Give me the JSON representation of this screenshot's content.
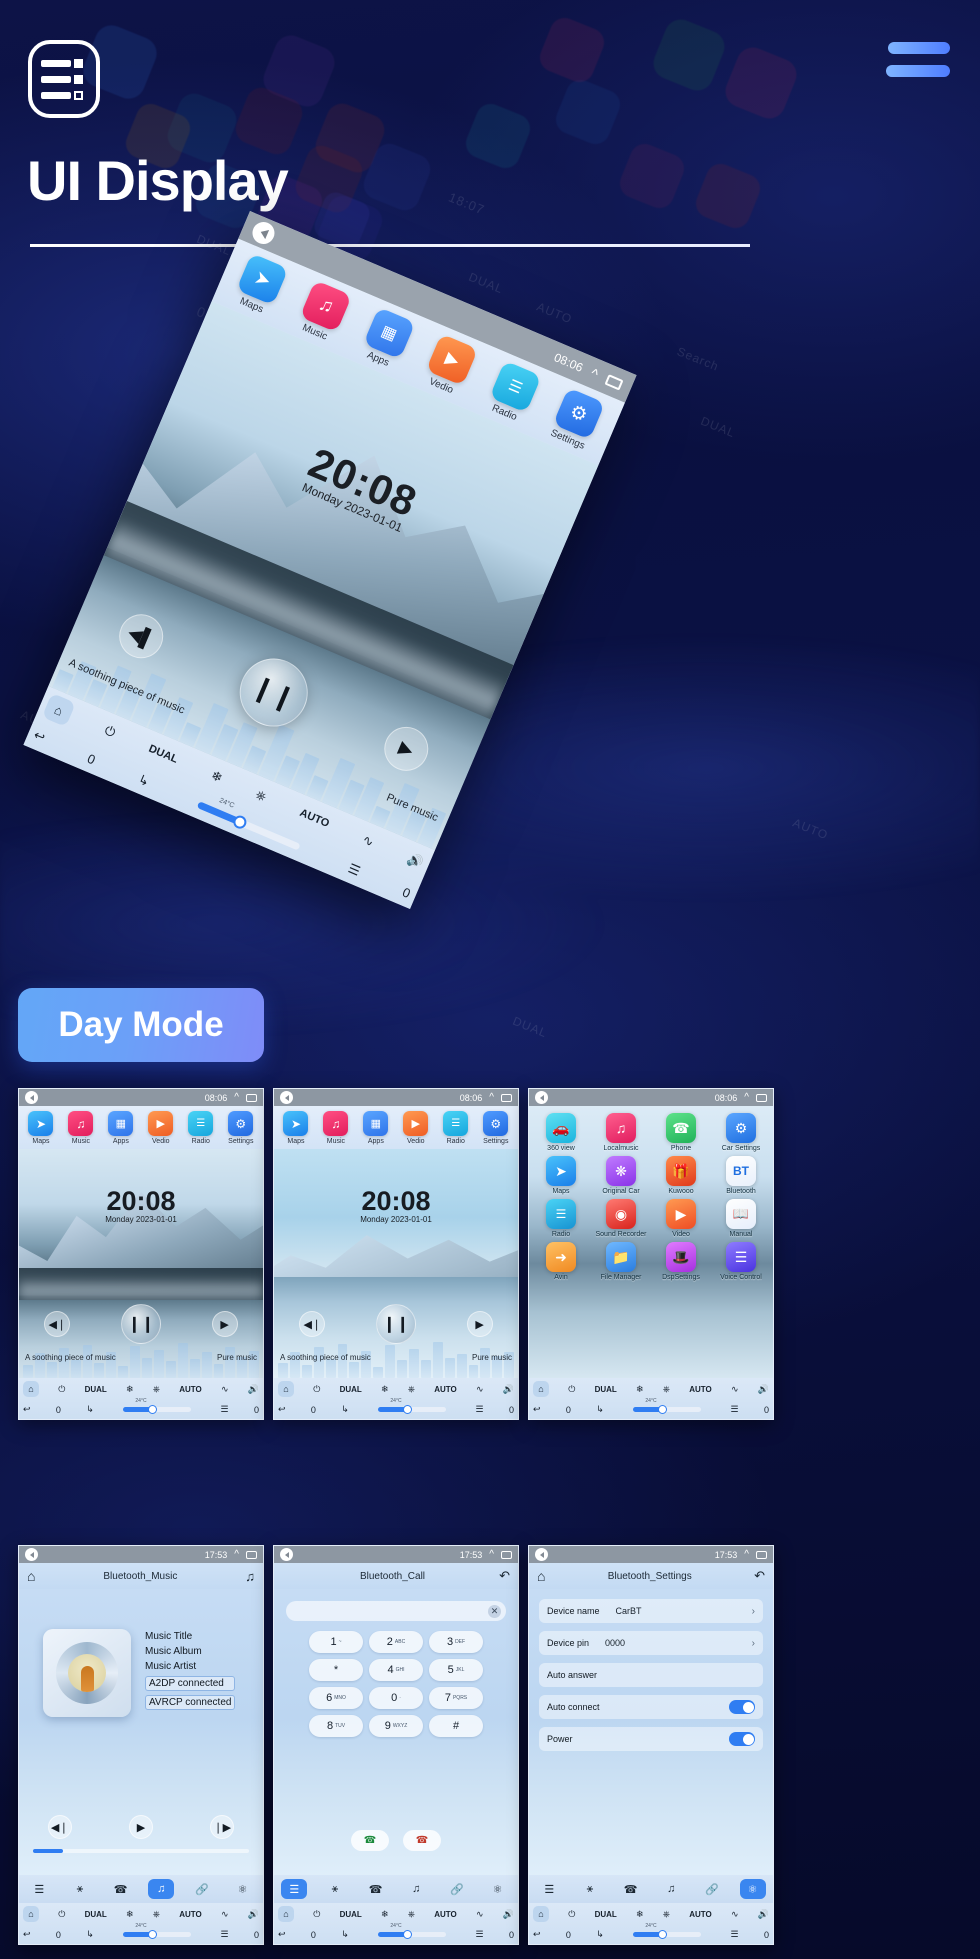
{
  "header": {
    "title": "UI Display",
    "logo_name": "list-logo",
    "menu_name": "hamburger-menu"
  },
  "badge": {
    "label": "Day Mode"
  },
  "hero": {
    "status_time": "08:06",
    "apps": [
      {
        "label": "Maps",
        "icon": "navigation-icon",
        "color": "#2aa3f5"
      },
      {
        "label": "Music",
        "icon": "music-note-icon",
        "color": "#f0356b"
      },
      {
        "label": "Apps",
        "icon": "grid-icon",
        "color": "#3d8bf5"
      },
      {
        "label": "Vedio",
        "icon": "play-icon",
        "color": "#f4703a"
      },
      {
        "label": "Radio",
        "icon": "radio-icon",
        "color": "#27b6e8"
      },
      {
        "label": "Settings",
        "icon": "gear-icon",
        "color": "#2f86f0"
      }
    ],
    "clock_time": "20:08",
    "clock_date": "Monday  2023-01-01",
    "track_left": "A soothing piece of music",
    "track_right": "Pure music",
    "media": {
      "prev": "prev-icon",
      "play": "pause-icon",
      "next": "next-icon"
    },
    "hvac": {
      "power": "0",
      "dual": "DUAL",
      "ac": "snowflake-icon",
      "defrost": "defrost-icon",
      "auto": "AUTO",
      "fan": "fan-icon",
      "temp": "24°C",
      "vol": "0"
    }
  },
  "thumbs": [
    {
      "id": "home-screen-1",
      "status_time": "08:06",
      "apps": [
        {
          "label": "Maps",
          "icon": "navigation-icon",
          "color": "#2aa3f5"
        },
        {
          "label": "Music",
          "icon": "music-note-icon",
          "color": "#f0356b"
        },
        {
          "label": "Apps",
          "icon": "grid-icon",
          "color": "#3d8bf5"
        },
        {
          "label": "Vedio",
          "icon": "play-icon",
          "color": "#f4703a"
        },
        {
          "label": "Radio",
          "icon": "radio-icon",
          "color": "#27b6e8"
        },
        {
          "label": "Settings",
          "icon": "gear-icon",
          "color": "#2f86f0"
        }
      ],
      "clock_time": "20:08",
      "clock_date": "Monday  2023-01-01",
      "track_left": "A soothing piece of music",
      "track_right": "Pure music",
      "hvac": {
        "dual": "DUAL",
        "auto": "AUTO",
        "temp": "24°C",
        "left_val": "0",
        "right_val": "0"
      }
    },
    {
      "id": "home-screen-2",
      "status_time": "08:06",
      "apps": [
        {
          "label": "Maps",
          "icon": "navigation-icon",
          "color": "#2aa3f5"
        },
        {
          "label": "Music",
          "icon": "music-note-icon",
          "color": "#f0356b"
        },
        {
          "label": "Apps",
          "icon": "grid-icon",
          "color": "#3d8bf5"
        },
        {
          "label": "Vedio",
          "icon": "play-icon",
          "color": "#f4703a"
        },
        {
          "label": "Radio",
          "icon": "radio-icon",
          "color": "#27b6e8"
        },
        {
          "label": "Settings",
          "icon": "gear-icon",
          "color": "#2f86f0"
        }
      ],
      "clock_time": "20:08",
      "clock_date": "Monday  2023-01-01",
      "track_left": "A soothing piece of music",
      "track_right": "Pure music",
      "hvac": {
        "dual": "DUAL",
        "auto": "AUTO",
        "temp": "24°C",
        "left_val": "0",
        "right_val": "0"
      }
    },
    {
      "id": "app-drawer",
      "status_time": "08:06",
      "grid": [
        {
          "label": "360 view",
          "icon": "car-360-icon",
          "color": "#2ec9e8"
        },
        {
          "label": "Localmusic",
          "icon": "music-note-icon",
          "color": "#f0356b"
        },
        {
          "label": "Phone",
          "icon": "phone-icon",
          "color": "#2ecc71"
        },
        {
          "label": "Car Settings",
          "icon": "gear-icon",
          "color": "#2f86f0"
        },
        {
          "label": "Maps",
          "icon": "navigation-icon",
          "color": "#2aa3f5"
        },
        {
          "label": "Original Car",
          "icon": "original-car-icon",
          "color": "#a35cf0"
        },
        {
          "label": "Kuwooo",
          "icon": "kuwo-icon",
          "color": "#f04b2e"
        },
        {
          "label": "Bluetooth",
          "icon": "bluetooth-icon",
          "color": "#2f86f0"
        },
        {
          "label": "Radio",
          "icon": "radio-icon",
          "color": "#27b6e8"
        },
        {
          "label": "Sound Recorder",
          "icon": "record-icon",
          "color": "#e8352f"
        },
        {
          "label": "Video",
          "icon": "play-icon",
          "color": "#f4703a"
        },
        {
          "label": "Manual",
          "icon": "book-icon",
          "color": "#3d6ef5"
        },
        {
          "label": "Avin",
          "icon": "avin-icon",
          "color": "#f5a03a"
        },
        {
          "label": "File Manager",
          "icon": "folder-icon",
          "color": "#3d9bf5"
        },
        {
          "label": "DspSettings",
          "icon": "sliders-icon",
          "color": "#c34df0"
        },
        {
          "label": "Voice Control",
          "icon": "waveform-icon",
          "color": "#5a4df0"
        }
      ],
      "hvac": {
        "dual": "DUAL",
        "auto": "AUTO",
        "temp": "24°C",
        "left_val": "0",
        "right_val": "0"
      }
    },
    {
      "id": "bluetooth-music",
      "status_time": "17:53",
      "title": "Bluetooth_Music",
      "meta": [
        "Music Title",
        "Music Album",
        "Music Artist"
      ],
      "chips": [
        "A2DP  connected",
        "AVRCP connected"
      ],
      "tabs": [
        "dialpad-icon",
        "contacts-icon",
        "phone-icon",
        "music-icon",
        "link-icon",
        "settings-icon"
      ],
      "active_tab": 3,
      "hvac": {
        "dual": "DUAL",
        "auto": "AUTO",
        "temp": "24°C",
        "left_val": "0",
        "right_val": "0"
      }
    },
    {
      "id": "bluetooth-call",
      "status_time": "17:53",
      "title": "Bluetooth_Call",
      "keys": [
        {
          "d": "1",
          "s": "~"
        },
        {
          "d": "2",
          "s": "ABC"
        },
        {
          "d": "3",
          "s": "DEF"
        },
        {
          "d": "*",
          "s": ""
        },
        {
          "d": "4",
          "s": "GHI"
        },
        {
          "d": "5",
          "s": "JKL"
        },
        {
          "d": "6",
          "s": "MNO"
        },
        {
          "d": "0",
          "s": "·"
        },
        {
          "d": "7",
          "s": "PQRS"
        },
        {
          "d": "8",
          "s": "TUV"
        },
        {
          "d": "9",
          "s": "WXYZ"
        },
        {
          "d": "#",
          "s": ""
        }
      ],
      "call_green": "call-icon",
      "call_red": "hangup-icon",
      "tabs": [
        "dialpad-icon",
        "contacts-icon",
        "phone-icon",
        "music-icon",
        "link-icon",
        "settings-icon"
      ],
      "active_tab": 0,
      "hvac": {
        "dual": "DUAL",
        "auto": "AUTO",
        "temp": "24°C",
        "left_val": "0",
        "right_val": "0"
      }
    },
    {
      "id": "bluetooth-settings",
      "status_time": "17:53",
      "title": "Bluetooth_Settings",
      "rows": [
        {
          "key": "Device name",
          "value": "CarBT",
          "type": "chevron"
        },
        {
          "key": "Device pin",
          "value": "0000",
          "type": "chevron"
        },
        {
          "key": "Auto answer",
          "value": "",
          "type": "toggle-off"
        },
        {
          "key": "Auto connect",
          "value": "",
          "type": "toggle-on"
        },
        {
          "key": "Power",
          "value": "",
          "type": "toggle-on"
        }
      ],
      "tabs": [
        "dialpad-icon",
        "contacts-icon",
        "phone-icon",
        "music-icon",
        "link-icon",
        "settings-icon"
      ],
      "active_tab": 5,
      "hvac": {
        "dual": "DUAL",
        "auto": "AUTO",
        "temp": "24°C",
        "left_val": "0",
        "right_val": "0"
      }
    }
  ],
  "ghost_labels": [
    "Maps",
    "Phone",
    "Original Car",
    "Kuwooo",
    "Bluetooth",
    "Radio",
    "Sound Recorder",
    "Video",
    "Manual",
    "Avin",
    "File Manager",
    "DspSettings",
    "Voice Control",
    "Music",
    "Local Music",
    "Car Settings",
    "360 view"
  ],
  "colors": {
    "accent": "#4f7dff",
    "badge_from": "#63a7f7",
    "badge_to": "#7f8cf8",
    "bg": "#0a1040"
  }
}
